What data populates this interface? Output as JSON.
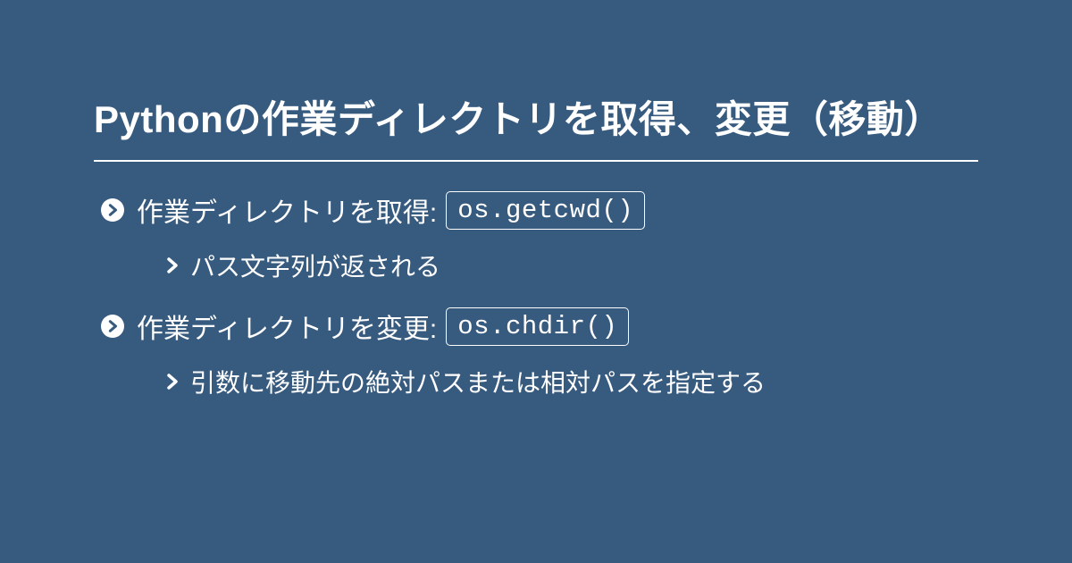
{
  "title": "Pythonの作業ディレクトリを取得、変更（移動）",
  "items": [
    {
      "label": "作業ディレクトリを取得:",
      "code": "os.getcwd()",
      "sub": "パス文字列が返される"
    },
    {
      "label": "作業ディレクトリを変更:",
      "code": "os.chdir()",
      "sub": "引数に移動先の絶対パスまたは相対パスを指定する"
    }
  ]
}
